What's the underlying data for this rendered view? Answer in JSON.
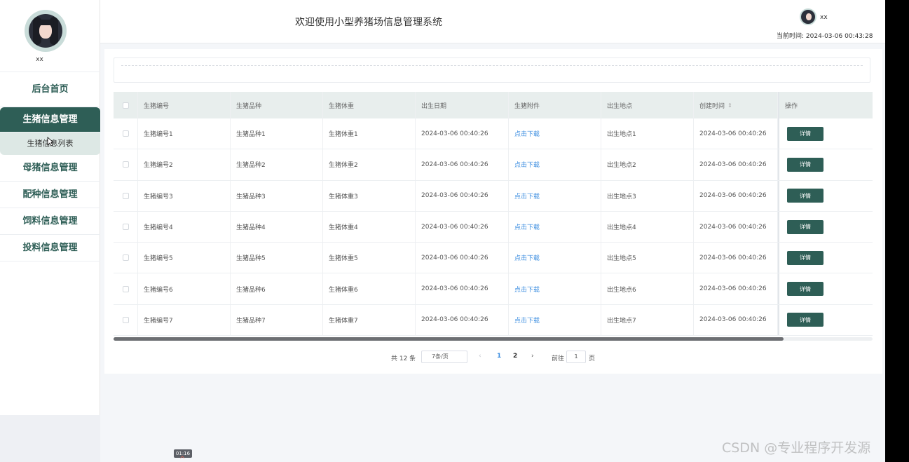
{
  "sidebar": {
    "username": "xx",
    "menu": {
      "home": "后台首页",
      "pig_info": "生猪信息管理",
      "pig_list": "生猪信息列表",
      "sow_info": "母猪信息管理",
      "breeding_info": "配种信息管理",
      "feed_info": "饲料信息管理",
      "feeding_info": "投料信息管理"
    }
  },
  "header": {
    "title": "欢迎使用小型养猪场信息管理系统",
    "username": "xx",
    "time_label": "当前时间:",
    "time_value": "2024-03-06 00:43:28"
  },
  "table": {
    "columns": [
      "生猪编号",
      "生猪品种",
      "生猪体重",
      "出生日期",
      "生猪附件",
      "出生地点",
      "创建时间",
      "操作"
    ],
    "rows": [
      [
        "生猪编号1",
        "生猪品种1",
        "生猪体重1",
        "2024-03-06 00:40:26",
        "点击下载",
        "出生地点1",
        "2024-03-06 00:40:26",
        "详情"
      ],
      [
        "生猪编号2",
        "生猪品种2",
        "生猪体重2",
        "2024-03-06 00:40:26",
        "点击下载",
        "出生地点2",
        "2024-03-06 00:40:26",
        "详情"
      ],
      [
        "生猪编号3",
        "生猪品种3",
        "生猪体重3",
        "2024-03-06 00:40:26",
        "点击下载",
        "出生地点3",
        "2024-03-06 00:40:26",
        "详情"
      ],
      [
        "生猪编号4",
        "生猪品种4",
        "生猪体重4",
        "2024-03-06 00:40:26",
        "点击下载",
        "出生地点4",
        "2024-03-06 00:40:26",
        "详情"
      ],
      [
        "生猪编号5",
        "生猪品种5",
        "生猪体重5",
        "2024-03-06 00:40:26",
        "点击下载",
        "出生地点5",
        "2024-03-06 00:40:26",
        "详情"
      ],
      [
        "生猪编号6",
        "生猪品种6",
        "生猪体重6",
        "2024-03-06 00:40:26",
        "点击下载",
        "出生地点6",
        "2024-03-06 00:40:26",
        "详情"
      ],
      [
        "生猪编号7",
        "生猪品种7",
        "生猪体重7",
        "2024-03-06 00:40:26",
        "点击下载",
        "出生地点7",
        "2024-03-06 00:40:26",
        "详情"
      ]
    ]
  },
  "pager": {
    "total": "共 12 条",
    "page_size": "7条/页",
    "prev": "‹",
    "page1": "1",
    "page2": "2",
    "next": "›",
    "goto_label": "前往",
    "goto_value": "1",
    "goto_suffix": "页"
  },
  "overlay": {
    "time_badge": "01:16",
    "watermark": "CSDN @专业程序开发源"
  },
  "colors": {
    "primary": "#2e5e56",
    "link": "#3c8ee0",
    "header_bg": "#e8eeed"
  }
}
